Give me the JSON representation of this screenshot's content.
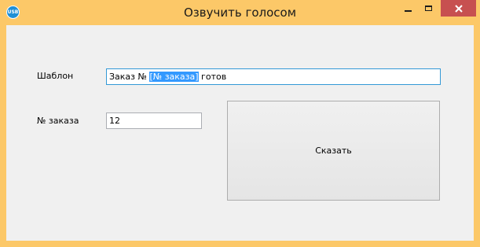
{
  "window": {
    "title": "Озвучить голосом",
    "icon": "usb-app-icon",
    "icon_text": "USB",
    "accent_color": "#fcc868",
    "close_button_color": "#c75050"
  },
  "form": {
    "template_label": "Шаблон",
    "template_value": {
      "before": "Заказ № ",
      "selected": "[№ заказа]",
      "after": " готов"
    },
    "order_label": "№ заказа",
    "order_value": "12",
    "say_button_label": "Сказать"
  }
}
